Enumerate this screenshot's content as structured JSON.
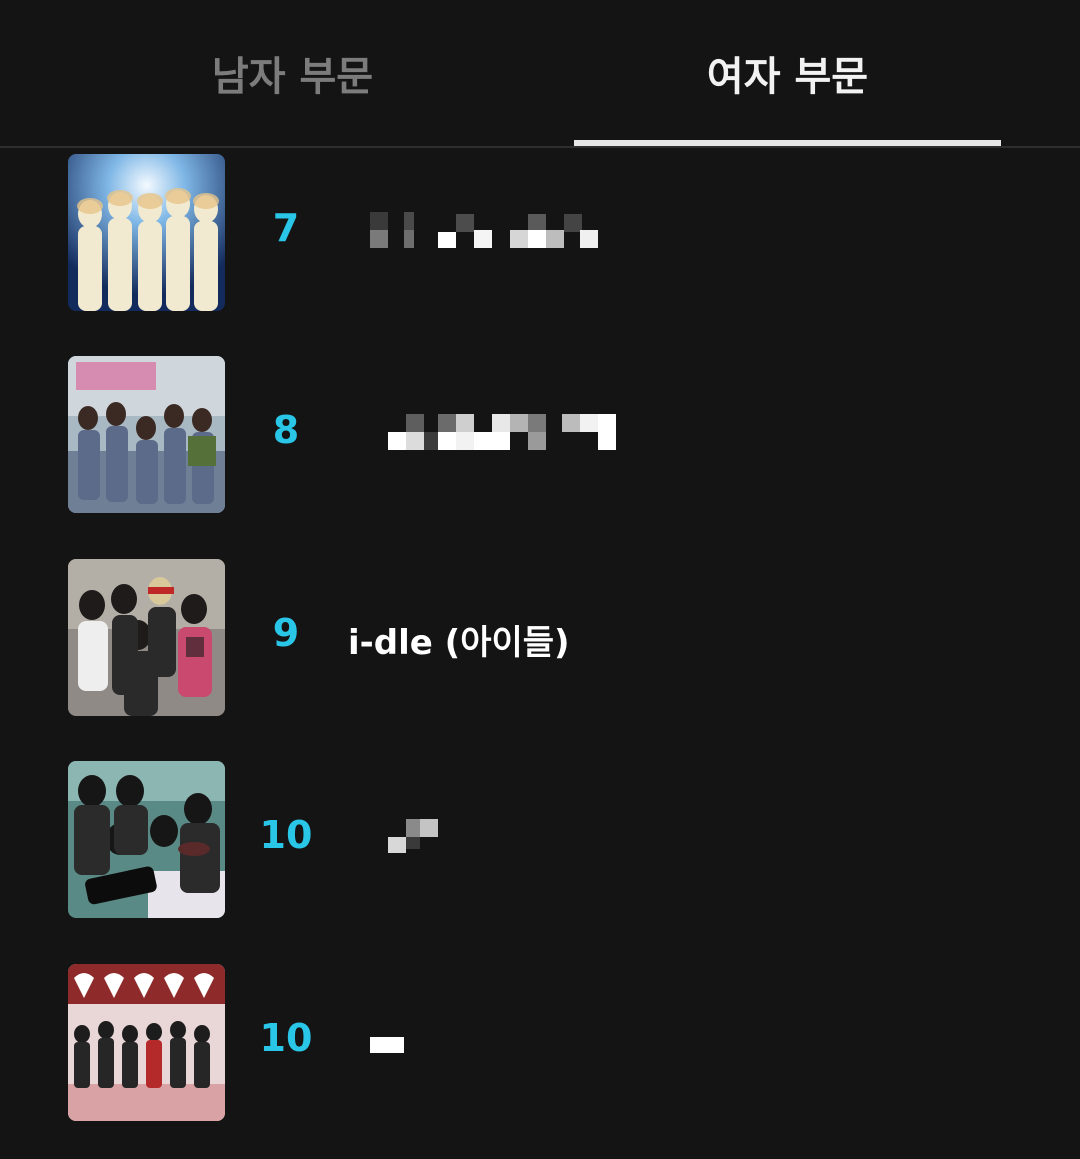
{
  "tabs": {
    "male_label": "남자 부문",
    "female_label": "여자 부문",
    "active": "female"
  },
  "accent_color": "#29c6e8",
  "rankings": [
    {
      "rank": "7",
      "name": "",
      "name_hidden": true
    },
    {
      "rank": "8",
      "name": "",
      "name_hidden": true
    },
    {
      "rank": "9",
      "name": "i-dle (아이들)",
      "name_hidden": false
    },
    {
      "rank": "10",
      "name": "",
      "name_hidden": true
    },
    {
      "rank": "10",
      "name": "",
      "name_hidden": true
    }
  ]
}
